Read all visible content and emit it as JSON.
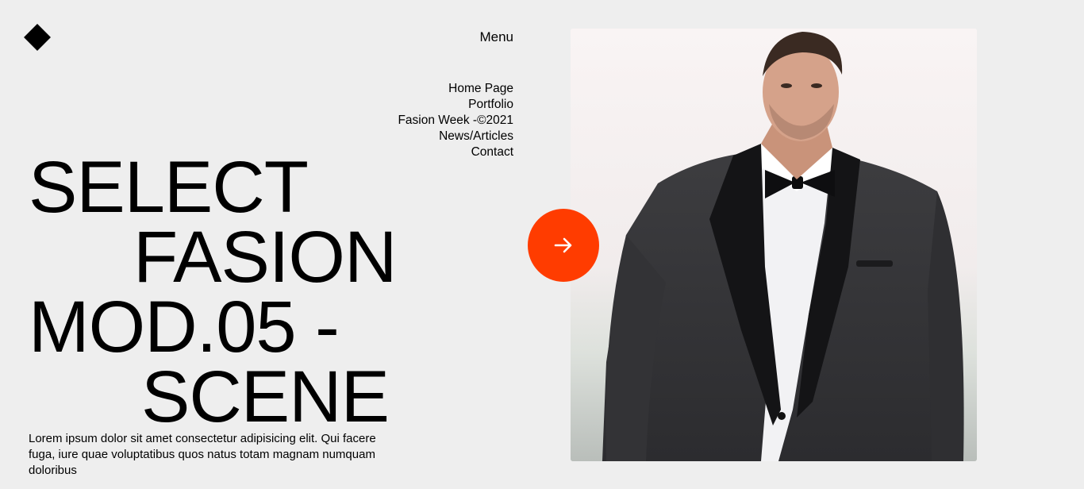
{
  "header": {
    "logo": "diamond-logo-icon",
    "menu_label": "Menu"
  },
  "nav": {
    "items": [
      {
        "label": "Home Page"
      },
      {
        "label": "Portfolio"
      },
      {
        "label": "Fasion Week -©2021"
      },
      {
        "label": "News/Articles"
      },
      {
        "label": "Contact"
      }
    ]
  },
  "hero": {
    "line1": "SELECT",
    "line2": "FASION",
    "line3": "MOD.05 -",
    "line4": "SCENE",
    "blurb": "Lorem ipsum dolor sit amet consectetur adipisicing elit. Qui facere fuga, iure quae voluptatibus quos natus totam magnam numquam doloribus"
  },
  "cta": {
    "icon": "arrow-right-icon",
    "color": "#ff3c00"
  },
  "photo": {
    "subject": "man-in-tuxedo-photo"
  }
}
